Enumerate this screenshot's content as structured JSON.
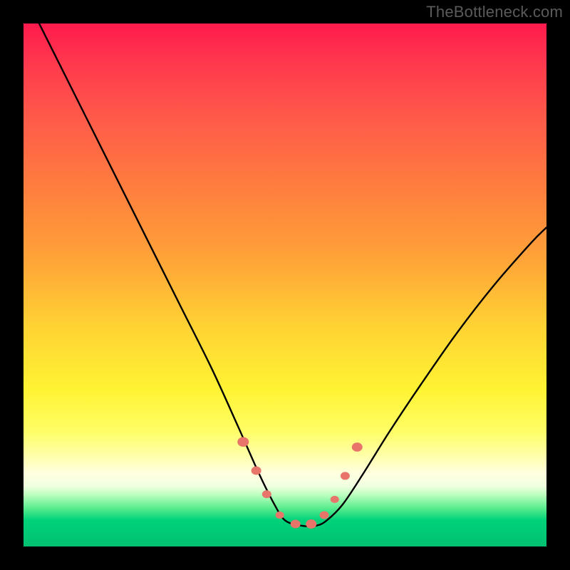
{
  "watermark": "TheBottleneck.com",
  "chart_data": {
    "type": "line",
    "title": "",
    "xlabel": "",
    "ylabel": "",
    "xlim": [
      0,
      100
    ],
    "ylim": [
      0,
      100
    ],
    "series": [
      {
        "name": "bottleneck-curve",
        "x": [
          0,
          6,
          12,
          18,
          24,
          30,
          36,
          41,
          45,
          48,
          50,
          53,
          56,
          58,
          61,
          65,
          70,
          76,
          83,
          90,
          97,
          100
        ],
        "values": [
          106,
          94,
          82,
          70,
          58,
          46,
          34,
          23,
          14,
          8,
          5,
          4,
          4,
          5,
          8,
          14,
          22,
          31,
          41,
          50,
          58,
          61
        ]
      }
    ],
    "markers": {
      "name": "highlight-dots",
      "color": "#e7756a",
      "x": [
        42.0,
        44.5,
        46.5,
        49.0,
        52.0,
        55.0,
        57.5,
        59.5,
        61.5,
        63.8
      ],
      "values": [
        20.0,
        14.5,
        10.0,
        6.0,
        4.3,
        4.3,
        6.0,
        9.0,
        13.5,
        19.0
      ],
      "radius": [
        8.0,
        7.0,
        6.5,
        6.0,
        7.0,
        7.5,
        6.5,
        6.0,
        6.5,
        7.5
      ]
    },
    "gradient_stops": [
      {
        "pos": 0.0,
        "color": "#ff1a4d"
      },
      {
        "pos": 0.18,
        "color": "#ff5a4a"
      },
      {
        "pos": 0.45,
        "color": "#ffa338"
      },
      {
        "pos": 0.7,
        "color": "#fff333"
      },
      {
        "pos": 0.86,
        "color": "#ffffe0"
      },
      {
        "pos": 0.93,
        "color": "#60ee90"
      },
      {
        "pos": 1.0,
        "color": "#00c070"
      }
    ]
  }
}
